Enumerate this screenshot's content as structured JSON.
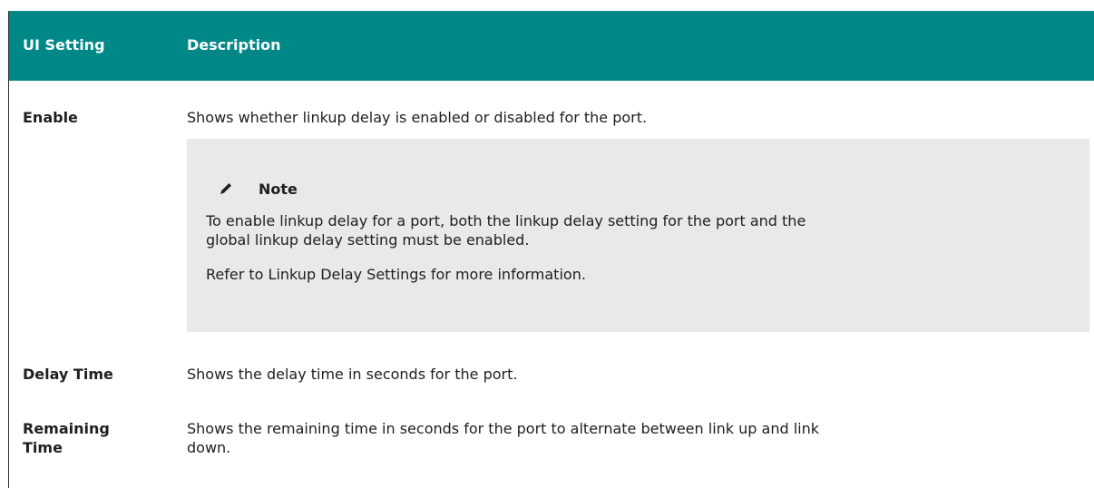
{
  "header": {
    "col_setting": "UI Setting",
    "col_description": "Description"
  },
  "rows": [
    {
      "setting": "Enable",
      "description": "Shows whether linkup delay is enabled or disabled for the port."
    },
    {
      "setting": "Delay Time",
      "description": "Shows the delay time in seconds for the port."
    },
    {
      "setting_lines": [
        "Remaining",
        "Time"
      ],
      "description_lines": [
        "Shows the remaining time in seconds for the port to alternate between link up and link",
        "down."
      ]
    }
  ],
  "note": {
    "icon": "pencil-icon",
    "title": "Note",
    "paragraph1_lines": [
      "To enable linkup delay for a port, both the linkup delay setting for the port and the",
      "global linkup delay setting must be enabled."
    ],
    "paragraph2": "Refer to Linkup Delay Settings for more information."
  },
  "colors": {
    "header_background": "#008787",
    "header_text": "#ffffff",
    "note_background": "#e9e9e9"
  }
}
